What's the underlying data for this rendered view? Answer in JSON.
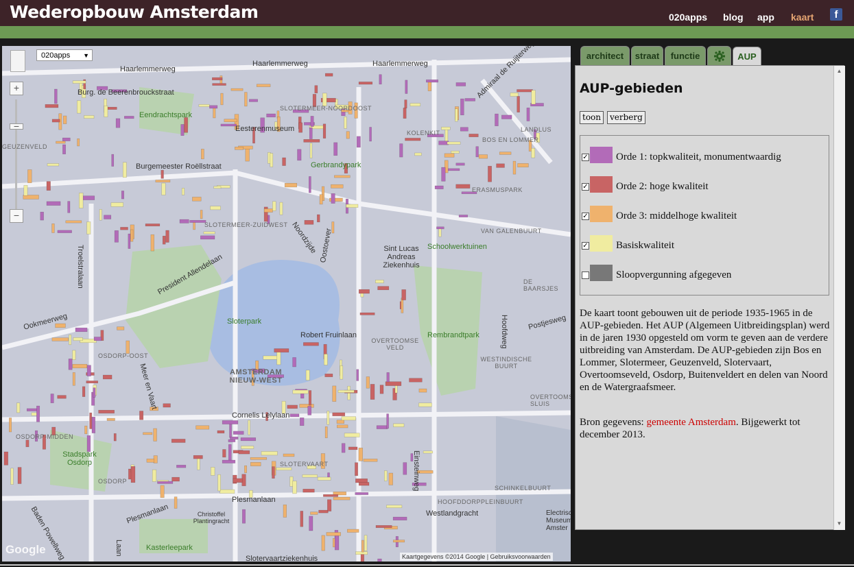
{
  "header": {
    "title": "Wederopbouw Amsterdam",
    "nav": [
      "020apps",
      "blog",
      "app",
      "kaart"
    ],
    "active_nav": "kaart",
    "facebook_glyph": "f",
    "colors": {
      "header_bg": "#3d2328",
      "accent_bar": "#6d9a54",
      "active_nav": "#e6a572"
    }
  },
  "map": {
    "dropdown_value": "020apps",
    "zoom_in": "+",
    "zoom_mid": "−",
    "zoom_out": "−",
    "labels": {
      "haarlemmerweg1": "Haarlemmerweg",
      "haarlemmerweg2": "Haarlemmerweg",
      "haarlemmerweg3": "Haarlemmerweg",
      "admiraal": "Admiraal de Ruijterweg",
      "beerenbrouck": "Burg. de Beerenbrouckstraat",
      "eendrachtspark": "Eendrachtspark",
      "lotermeer": "SLOTERMEER-NOORDOOST",
      "esterenmuseum": "Eesterenmuseum",
      "kolenkit": "KOLENKIT",
      "landlus": "LANDLUS",
      "bosenlommer": "BOS EN LOMMER",
      "geuzenveld": "GEUZENVELD",
      "burgemeester": "Burgemeester Roëllstraat",
      "gerbrandypark": "Gerbrandypark",
      "erasmuspark": "ERASMUSPARK",
      "slotermeerzw": "SLOTERMEER-ZUIDWEST",
      "noordzijde": "Noordzijde",
      "vangalenbuurt": "VAN GALENBUURT",
      "troelstralaan": "Troelstralaan",
      "presidentallende": "President Allendelaan",
      "sintlucas": "Sint Lucas Andreas Ziekenhuis",
      "schoolwerktuinen": "Schoolwerktuinen",
      "oostoever": "Oostoever",
      "sloterpark": "Sloterpark",
      "debaarsjes": "DE BAARSJES",
      "okmeerweg": "Ookmeerweg",
      "robertfruin": "Robert Fruinlaan",
      "rembrandtpark": "Rembrandtpark",
      "postjesweg": "Postjesweg",
      "hoofdweg": "Hoofdweg",
      "osdorpoost": "OSDORP-OOST",
      "overtoomseveld": "OVERTOOMSE VELD",
      "westindische": "WESTINDISCHE BUURT",
      "nieuwwest": "AMSTERDAM NIEUW-WEST",
      "meerenvaart": "Meer en Vaart",
      "overtoomsesluis": "OVERTOOMSE SLUIS",
      "cornelislelylaan": "Cornelis Lelylaan",
      "osdorpmidden": "OSDORP-MIDDEN",
      "stadsparkosdorp": "Stadspark Osdorp",
      "slotervaart": "SLOTERVAART",
      "einsteinweg": "Einsteinweg",
      "schinkelbuurt": "SCHINKELBUURT",
      "osdorp": "OSDORP",
      "plesmanlaan1": "Plesmanlaan",
      "plesmanlaan2": "Plesmanlaan",
      "hoofddorpplein": "HOOFDDORPPLEINBUURT",
      "westlandgracht": "Westlandgracht",
      "christoffel": "Christoffel Plantingracht",
      "electrischmuseum": "Electrisch Museum Amster",
      "badenpowell": "Baden Powellweg",
      "kasterleepark": "Kasterleepark",
      "slotervaartziekenhuis": "Slotervaartziekenhuis",
      "laan": "Laan"
    },
    "copyright": "Kaartgegevens ©2014 Google | Gebruiksvoorwaarden",
    "google_logo": "Google"
  },
  "tabs": [
    {
      "label": "architect",
      "active": false
    },
    {
      "label": "straat",
      "active": false
    },
    {
      "label": "functie",
      "active": false
    },
    {
      "label": "",
      "icon": "gear-icon",
      "active": false
    },
    {
      "label": "AUP",
      "active": true
    }
  ],
  "panel": {
    "title": "AUP-gebieden",
    "btn_show": "toon",
    "btn_hide": "verberg",
    "legend": [
      {
        "label": "Orde 1: topkwaliteit, monumentwaardig",
        "color": "#b26bb8",
        "checked": true
      },
      {
        "label": "Orde 2: hoge kwaliteit",
        "color": "#c86464",
        "checked": true
      },
      {
        "label": "Orde 3: middelhoge kwaliteit",
        "color": "#efb26d",
        "checked": true
      },
      {
        "label": "Basiskwaliteit",
        "color": "#f0eca0",
        "checked": true
      },
      {
        "label": "Sloopvergunning afgegeven",
        "color": "#787878",
        "checked": false
      }
    ],
    "description": "De kaart toont gebouwen uit de periode 1935-1965 in de AUP-gebieden. Het AUP (Algemeen Uitbreidingsplan) werd in de jaren 1930 opgesteld om vorm te geven aan de verdere uitbreiding van Amsterdam. De AUP-gebieden zijn Bos en Lommer, Slotermeer, Geuzenveld, Slotervaart, Overtoomseveld, Osdorp, Buitenveldert en delen van Noord en de Watergraafsmeer.",
    "source_prefix": "Bron gegevens: ",
    "source_link": "gemeente Amsterdam",
    "source_suffix": ". Bijgewerkt tot december 2013."
  }
}
